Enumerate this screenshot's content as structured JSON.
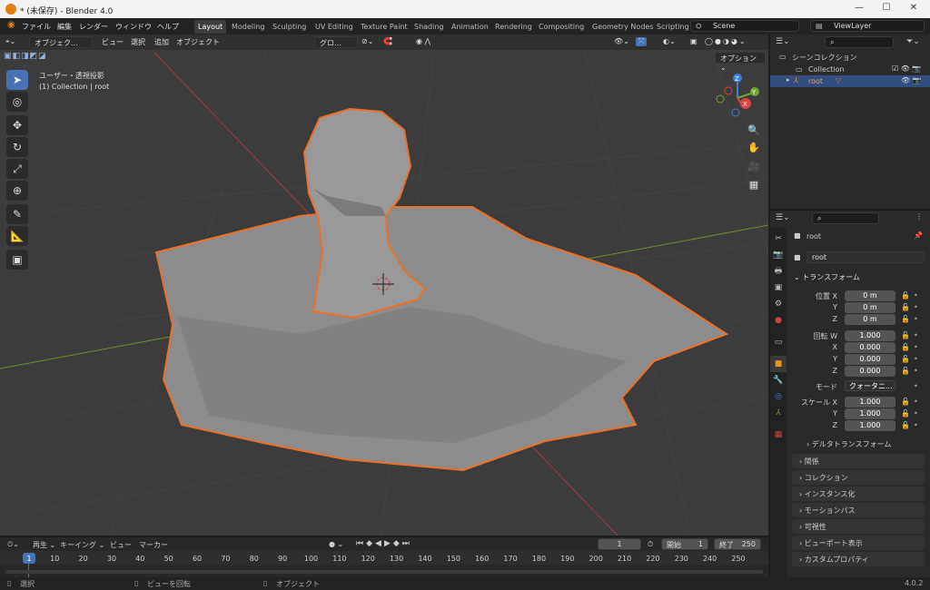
{
  "window": {
    "title": "* (未保存) - Blender 4.0",
    "minimize": "—",
    "maximize": "☐",
    "close": "✕"
  },
  "menu": [
    "ファイル",
    "編集",
    "レンダー",
    "ウィンドウ",
    "ヘルプ"
  ],
  "workspaces": [
    "Layout",
    "Modeling",
    "Sculpting",
    "UV Editing",
    "Texture Paint",
    "Shading",
    "Animation",
    "Rendering",
    "Compositing",
    "Geometry Nodes",
    "Scripting"
  ],
  "scene": {
    "name": "Scene",
    "view_layer": "ViewLayer"
  },
  "viewport": {
    "mode": "オブジェク...",
    "menus": [
      "ビュー",
      "選択",
      "追加",
      "オブジェクト"
    ],
    "transform_orientation": "グロ...",
    "options": "オプション",
    "view_label": "ユーザー・透視投影",
    "collection_label": "(1) Collection | root",
    "gizmo": {
      "z": "Z",
      "y": "Y",
      "x": "X"
    }
  },
  "outliner": {
    "search_placeholder": "",
    "scene_collection": "シーンコレクション",
    "collection": "Collection",
    "object": "root"
  },
  "properties": {
    "object_name": "root",
    "name_field": "root",
    "transform_header": "トランスフォーム",
    "location_label": "位置 X",
    "y_label": "Y",
    "z_label": "Z",
    "x_label": "X",
    "rotation_label": "回転 W",
    "location": [
      "0 m",
      "0 m",
      "0 m"
    ],
    "rotation": [
      "1.000",
      "0.000",
      "0.000",
      "0.000"
    ],
    "mode_label": "モード",
    "mode_value": "クォータニ...",
    "scale_label": "スケール X",
    "scale": [
      "1.000",
      "1.000",
      "1.000"
    ],
    "delta_transform": "デルタトランスフォーム",
    "panels": [
      "関係",
      "コレクション",
      "インスタンス化",
      "モーションパス",
      "可視性",
      "ビューポート表示",
      "カスタムプロパティ"
    ]
  },
  "timeline": {
    "menus": [
      "再生",
      "キーイング",
      "ビュー",
      "マーカー"
    ],
    "current_frame": "1",
    "start_label": "開始",
    "start": "1",
    "end_label": "終了",
    "end": "250",
    "ticks": [
      "1",
      "10",
      "20",
      "30",
      "40",
      "50",
      "60",
      "70",
      "80",
      "90",
      "100",
      "110",
      "120",
      "130",
      "140",
      "150",
      "160",
      "170",
      "180",
      "190",
      "200",
      "210",
      "220",
      "230",
      "240",
      "250"
    ]
  },
  "statusbar": {
    "select": "選択",
    "rotate_view": "ビューを回転",
    "object": "オブジェクト",
    "version": "4.0.2"
  },
  "colors": {
    "accent": "#4772b3",
    "selection": "#e8702a",
    "x_axis": "#a33b3b",
    "y_axis": "#6a8c2d"
  }
}
